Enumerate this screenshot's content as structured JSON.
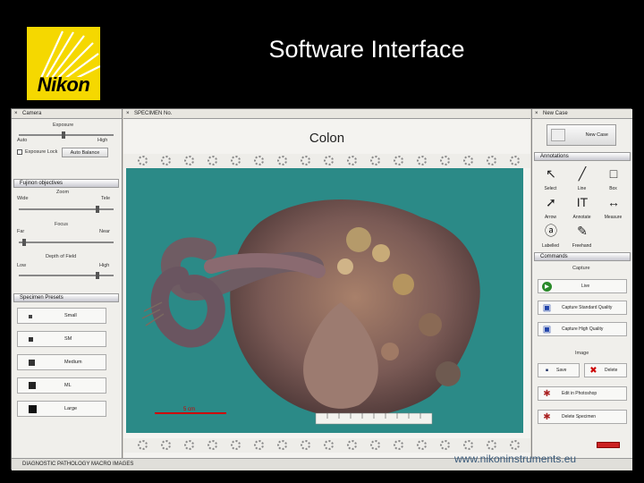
{
  "slide": {
    "title": "Software Interface",
    "logo_text": "Nikon",
    "watermark": "www.nikoninstruments.eu"
  },
  "left_panel": {
    "header": "Camera",
    "exposure_label": "Exposure",
    "exposure_left": "Auto",
    "exposure_right": "High",
    "exposure_auto_label": "Exposure Lock",
    "exposure_button": "Auto Balance",
    "objectives_header": "Fujinon objectives",
    "zoom_label": "Zoom",
    "zoom_left": "Wide",
    "zoom_right": "Tele",
    "focus_label": "Focus",
    "focus_left": "Far",
    "focus_right": "Near",
    "depth_label": "Depth of Field",
    "depth_left": "Low",
    "depth_right": "High",
    "presets_header": "Specimen Presets",
    "presets": [
      {
        "label": "Small",
        "color": "#444"
      },
      {
        "label": "SM",
        "color": "#333"
      },
      {
        "label": "Medium",
        "color": "#333"
      },
      {
        "label": "ML",
        "color": "#222"
      },
      {
        "label": "Large",
        "color": "#111"
      }
    ]
  },
  "center": {
    "header": "SPECIMEN No.",
    "specimen_title": "Colon",
    "scale_label": "5 cm",
    "ruler_ticks": [
      "1",
      "2",
      "3",
      "4",
      "5",
      "6",
      "7",
      "8",
      "9",
      "10"
    ]
  },
  "right_panel": {
    "new_case_header": "New Case",
    "new_case_button": "New Case",
    "annotations_header": "Annotations",
    "tools": [
      {
        "label": "Select",
        "icon": "cursor-icon",
        "glyph": "↖"
      },
      {
        "label": "Line",
        "icon": "line-icon",
        "glyph": "╱"
      },
      {
        "label": "Box",
        "icon": "box-icon",
        "glyph": "□"
      },
      {
        "label": "Arrow",
        "icon": "arrow-icon",
        "glyph": "➚"
      },
      {
        "label": "Annotate",
        "icon": "text-icon",
        "glyph": "IT"
      },
      {
        "label": "Measure",
        "icon": "measure-icon",
        "glyph": "↔"
      },
      {
        "label": "Labelled",
        "icon": "labelled-icon",
        "glyph": "ⓐ"
      },
      {
        "label": "Freehand",
        "icon": "pen-icon",
        "glyph": "✎"
      }
    ],
    "commands_header": "Commands",
    "capture_label": "Capture",
    "live_button": "Live",
    "capture_standard": "Capture Standard Quality",
    "capture_high": "Capture High Quality",
    "image_label": "Image",
    "save_button": "Save",
    "delete_button": "Delete",
    "edit_button": "Edit in Photoshop",
    "delete_all_button": "Delete Specimen"
  },
  "status": {
    "text": "DIAGNOSTIC PATHOLOGY MACRO IMAGES"
  }
}
